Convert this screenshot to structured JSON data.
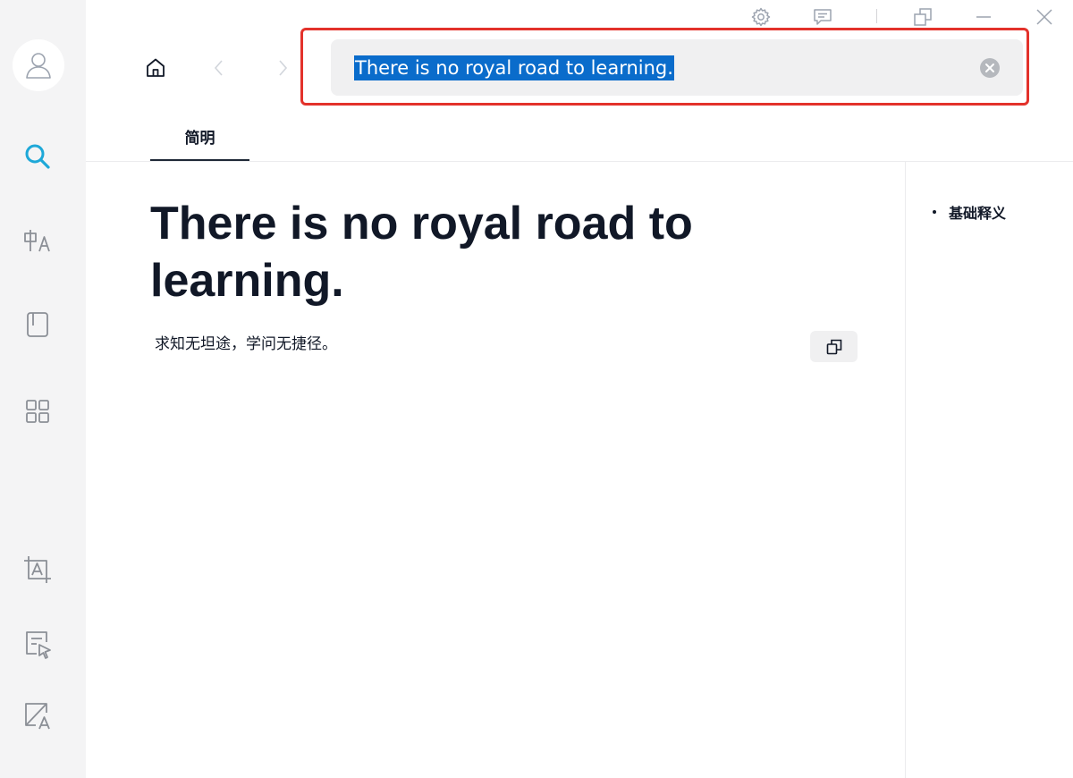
{
  "colors": {
    "accent": "#1ea8d8",
    "highlight_border": "#e3322b",
    "selection_bg": "#0a6ccb",
    "sidebar_bg": "#f4f4f5",
    "search_bg": "#f0f0f1"
  },
  "sidebar": {
    "items": [
      {
        "name": "avatar",
        "icon": "user-icon"
      },
      {
        "name": "search",
        "icon": "search-icon",
        "active": true
      },
      {
        "name": "translate",
        "icon": "translate-icon"
      },
      {
        "name": "wordbook",
        "icon": "book-icon"
      },
      {
        "name": "apps",
        "icon": "grid-icon"
      },
      {
        "name": "screenshot-translate",
        "icon": "image-text-icon"
      },
      {
        "name": "select-translate",
        "icon": "cursor-select-icon"
      },
      {
        "name": "document-translate",
        "icon": "doc-edit-icon"
      }
    ]
  },
  "titlebar": {
    "icons": [
      "gear-icon",
      "feedback-icon",
      "pin-window-icon",
      "minimize-icon",
      "close-icon"
    ]
  },
  "nav": {
    "icons": [
      "home-icon",
      "chevron-left-icon",
      "chevron-right-icon"
    ]
  },
  "search": {
    "value": "There is no royal road to learning.",
    "clear_icon": "clear-circle-icon"
  },
  "tabs": [
    {
      "label": "简明",
      "active": true
    }
  ],
  "result": {
    "phrase": "There is no royal road to learning.",
    "translation": "求知无坦途，学问无捷径。",
    "copy_icon": "copy-icon"
  },
  "outline": {
    "items": [
      {
        "label": "基础释义"
      }
    ]
  }
}
